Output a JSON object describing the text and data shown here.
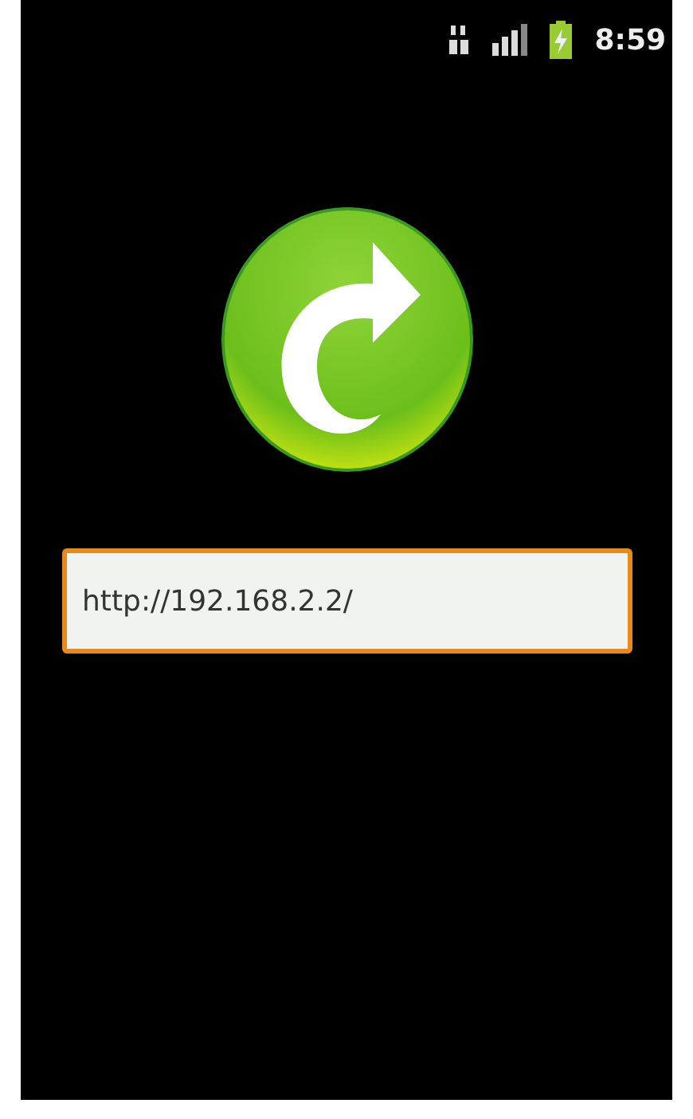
{
  "status_bar": {
    "time": "8:59"
  },
  "url_field": {
    "value": "http://192.168.2.2/"
  }
}
